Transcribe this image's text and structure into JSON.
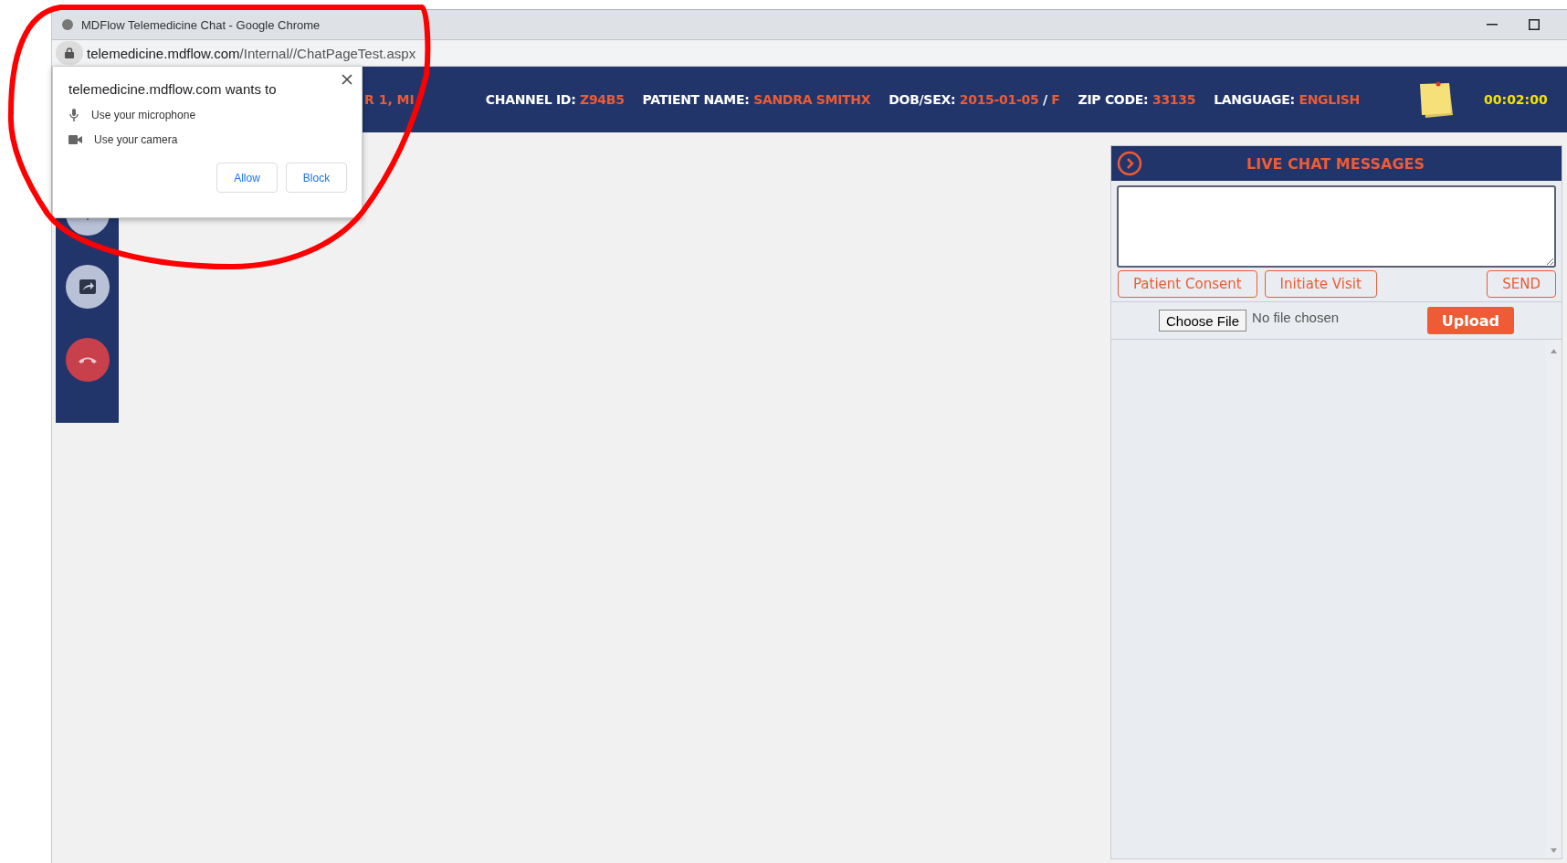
{
  "window": {
    "title": "MDFlow Telemedicine Chat - Google Chrome"
  },
  "address_bar": {
    "host": "telemedicine.mdflow.com",
    "path": "/Internal//ChatPageTest.aspx"
  },
  "header": {
    "cut_text": "R 1, MI",
    "fields": [
      {
        "label": "CHANNEL ID:",
        "parts": [
          {
            "kind": "value",
            "text": "Z94B5"
          }
        ]
      },
      {
        "label": "PATIENT NAME:",
        "parts": [
          {
            "kind": "value",
            "text": "SANDRA SMITHX"
          }
        ]
      },
      {
        "label": "DOB/SEX:",
        "parts": [
          {
            "kind": "value",
            "text": "2015-01-05"
          },
          {
            "kind": "separator",
            "text": "/"
          },
          {
            "kind": "value",
            "text": "F"
          }
        ]
      },
      {
        "label": "ZIP CODE:",
        "parts": [
          {
            "kind": "value",
            "text": "33135"
          }
        ]
      },
      {
        "label": "LANGUAGE:",
        "parts": [
          {
            "kind": "value",
            "text": "ENGLISH"
          }
        ]
      }
    ],
    "timer": "00:02:00"
  },
  "sidebar": {
    "buttons": [
      {
        "kind": "microphone"
      },
      {
        "kind": "share"
      },
      {
        "kind": "hangup"
      }
    ]
  },
  "permission_popup": {
    "title": "telemedicine.mdflow.com wants to",
    "permissions": [
      {
        "kind": "microphone",
        "label": "Use your microphone"
      },
      {
        "kind": "camera",
        "label": "Use your camera"
      }
    ],
    "buttons": [
      "Allow",
      "Block"
    ]
  },
  "chat": {
    "title": "LIVE CHAT MESSAGES",
    "actions": [
      "Patient Consent",
      "Initiate Visit"
    ],
    "send": "SEND",
    "file": {
      "button": "Choose File",
      "status": "No file chosen"
    },
    "upload": "Upload"
  },
  "annotation": {
    "kind": "freehand-circle"
  }
}
